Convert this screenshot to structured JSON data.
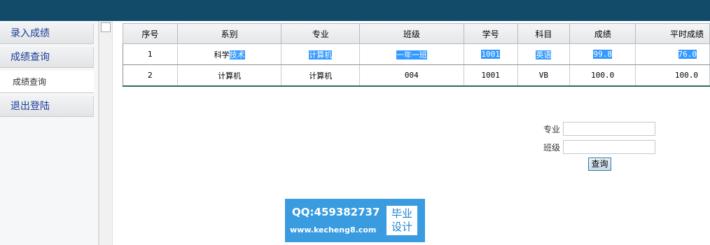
{
  "sidebar": {
    "items": [
      {
        "label": "录入成绩"
      },
      {
        "label": "成绩查询"
      },
      {
        "label": "成绩查询"
      },
      {
        "label": "退出登陆"
      }
    ]
  },
  "table": {
    "columns": [
      "序号",
      "系别",
      "专业",
      "班级",
      "学号",
      "科目",
      "成绩",
      "平时成绩"
    ],
    "rows": [
      {
        "index": "1",
        "dept_a": "科学",
        "dept_b": "技术",
        "major": "计算机",
        "class": "一年一班",
        "student_id": "1001",
        "subject": "英语",
        "score": "99.8",
        "usual_score": "76.0",
        "selected": true
      },
      {
        "index": "2",
        "dept": "计算机",
        "major": "计算机",
        "class": "004",
        "student_id": "1001",
        "subject": "VB",
        "score": "100.0",
        "usual_score": "100.0",
        "selected": false
      }
    ]
  },
  "search": {
    "major_label": "专业",
    "major_value": "",
    "class_label": "班级",
    "class_value": "",
    "submit_label": "查询"
  },
  "watermark": {
    "qq": "QQ:459382737",
    "url": "www.kecheng8.com",
    "badge_line1": "毕业",
    "badge_line2": "设计"
  },
  "colors": {
    "topbar": "#124a6a",
    "selection": "#3399ff",
    "sidebar_text": "#1a3e9a",
    "watermark_bg": "#3a9ce0"
  }
}
